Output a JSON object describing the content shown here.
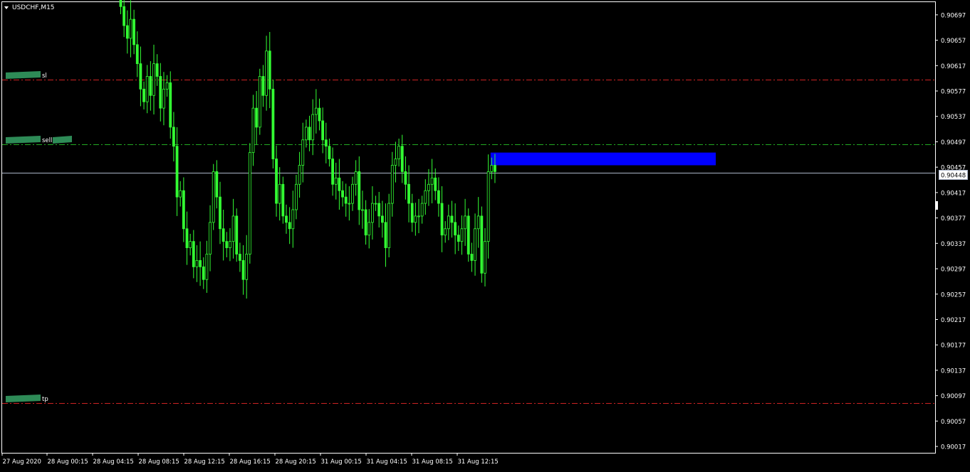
{
  "window": {
    "title": "USDCHF,M15",
    "current_price_label": "0.90448"
  },
  "colors": {
    "background": "#000000",
    "frame": "#ffffff",
    "candle": "#33ff33",
    "sl_line": "#cc2222",
    "tp_line": "#cc2222",
    "sell_line": "#22aa22",
    "bid_line": "#aab4c8",
    "zone": "#0000ff",
    "tag": "#2e8b57",
    "text": "#ffffff"
  },
  "lines": [
    {
      "key": "sl",
      "label": "sl",
      "price": 0.90595,
      "style": "dash-dot",
      "color_key": "sl_line"
    },
    {
      "key": "sell",
      "label": "sell",
      "price": 0.90493,
      "style": "dash-dot",
      "color_key": "sell_line"
    },
    {
      "key": "tp",
      "label": "tp",
      "price": 0.90085,
      "style": "dash-dot",
      "color_key": "tp_line"
    }
  ],
  "zone": {
    "x_start_bar": 112,
    "x_end_bar": 180,
    "price_high": 0.9048,
    "price_low": 0.9046
  },
  "chart_data": {
    "type": "line",
    "symbol": "USDCHF",
    "timeframe": "M15",
    "title": "USDCHF,M15",
    "ylim": [
      0.9001,
      0.907
    ],
    "y_ticks": [
      "0.90697",
      "0.90657",
      "0.90617",
      "0.90577",
      "0.90537",
      "0.90497",
      "0.90457",
      "0.90417",
      "0.90377",
      "0.90337",
      "0.90297",
      "0.90257",
      "0.90217",
      "0.90177",
      "0.90137",
      "0.90097",
      "0.90057",
      "0.90017"
    ],
    "x_ticks": [
      "27 Aug 2020",
      "28 Aug 00:15",
      "28 Aug 04:15",
      "28 Aug 08:15",
      "28 Aug 12:15",
      "28 Aug 16:15",
      "28 Aug 20:15",
      "31 Aug 00:15",
      "31 Aug 04:15",
      "31 Aug 08:15",
      "31 Aug 12:15"
    ],
    "current_price": 0.90448,
    "series": [
      {
        "values": [
          0.9071,
          0.9068,
          0.9066,
          0.9069,
          0.9065,
          0.9062,
          0.9058,
          0.9056,
          0.906,
          0.9057,
          0.9062,
          0.906,
          0.9055,
          0.9058,
          0.9059,
          0.9052,
          0.9049,
          0.9041,
          0.9042,
          0.9036,
          0.9033,
          0.9034,
          0.903,
          0.9031,
          0.903,
          0.9028,
          0.9032,
          0.9037,
          0.9045,
          0.9041,
          0.9036,
          0.9034,
          0.9033,
          0.9034,
          0.9038,
          0.9032,
          0.9031,
          0.9028,
          0.9032,
          0.9048,
          0.9055,
          0.9052,
          0.906,
          0.9057,
          0.9064,
          0.9058,
          0.9047,
          0.904,
          0.9043,
          0.9038,
          0.9037,
          0.9036,
          0.9039,
          0.9043,
          0.9046,
          0.905,
          0.9052,
          0.905,
          0.9054,
          0.9055,
          0.9053,
          0.905,
          0.9049,
          0.9047,
          0.9043,
          0.9044,
          0.9042,
          0.9041,
          0.904,
          0.904,
          0.9043,
          0.9045,
          0.9039,
          0.9039,
          0.9035,
          0.9037,
          0.904,
          0.904,
          0.9038,
          0.9037,
          0.9033,
          0.904,
          0.9046,
          0.9047,
          0.9049,
          0.9045,
          0.9043,
          0.904,
          0.9037,
          0.9038,
          0.9038,
          0.904,
          0.9042,
          0.9043,
          0.9044,
          0.9042,
          0.904,
          0.9035,
          0.9036,
          0.9038,
          0.9037,
          0.9035,
          0.9034,
          0.9036,
          0.9038,
          0.9032,
          0.9031,
          0.9036,
          0.9038,
          0.9029,
          0.9034,
          0.9045,
          0.9046,
          0.9045
        ]
      }
    ]
  }
}
